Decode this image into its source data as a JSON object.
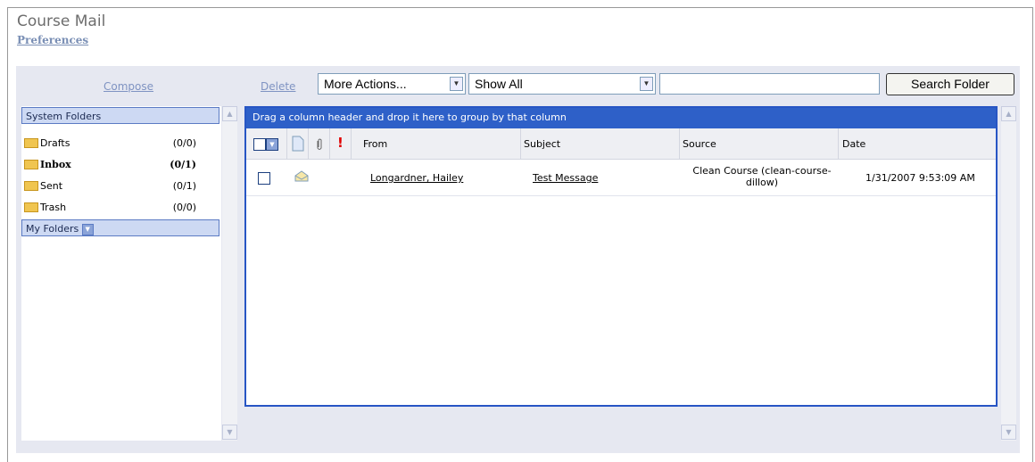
{
  "header": {
    "title": "Course Mail",
    "preferences": "Preferences"
  },
  "toolbar": {
    "compose": "Compose",
    "delete": "Delete",
    "more_actions": "More Actions...",
    "show_filter": "Show All",
    "search_value": "",
    "search_button": "Search Folder"
  },
  "sidebar": {
    "system_folders_label": "System Folders",
    "folders": [
      {
        "name": "Drafts",
        "count": "(0/0)"
      },
      {
        "name": "Inbox",
        "count": "(0/1)"
      },
      {
        "name": "Sent",
        "count": "(0/1)"
      },
      {
        "name": "Trash",
        "count": "(0/0)"
      }
    ],
    "my_folders_label": "My Folders"
  },
  "grid": {
    "group_hint": "Drag a column header and drop it here to group by that column",
    "columns": {
      "from": "From",
      "subject": "Subject",
      "source": "Source",
      "date": "Date"
    },
    "rows": [
      {
        "from": "Longardner, Hailey",
        "subject": "Test Message",
        "source": "Clean Course (clean-course-dillow)",
        "date": "1/31/2007 9:53:09 AM"
      }
    ]
  },
  "colors": {
    "accent": "#2e60c8",
    "panel": "#e6e8f1",
    "link_muted": "#7f93c2"
  }
}
